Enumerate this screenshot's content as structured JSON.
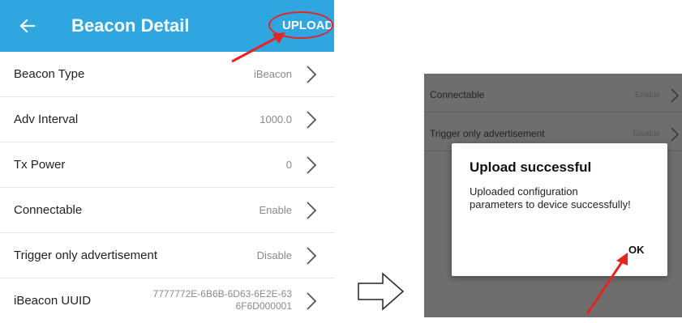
{
  "app_bar": {
    "title": "Beacon Detail",
    "upload_label": "UPLOAD",
    "color": "#2fa6e0"
  },
  "settings": [
    {
      "label": "Beacon Type",
      "value": "iBeacon"
    },
    {
      "label": "Adv Interval",
      "value": "1000.0"
    },
    {
      "label": "Tx Power",
      "value": "0"
    },
    {
      "label": "Connectable",
      "value": "Enable"
    },
    {
      "label": "Trigger only advertisement",
      "value": "Disable"
    },
    {
      "label": "iBeacon UUID",
      "value_line1": "7777772E-6B6B-6D63-6E2E-63",
      "value_line2": "6F6D000001"
    }
  ],
  "dimmed_settings": [
    {
      "label": "Connectable",
      "value": "Enable"
    },
    {
      "label": "Trigger only advertisement",
      "value": "Disable"
    }
  ],
  "dialog": {
    "title": "Upload successful",
    "message": "Uploaded configuration parameters to device successfully!",
    "ok_label": "OK"
  },
  "annotation_color": "#e52424",
  "icons": [
    "back-arrow-icon",
    "chevron-right-icon",
    "hollow-right-arrow-icon",
    "red-pointer-arrow-icon"
  ]
}
